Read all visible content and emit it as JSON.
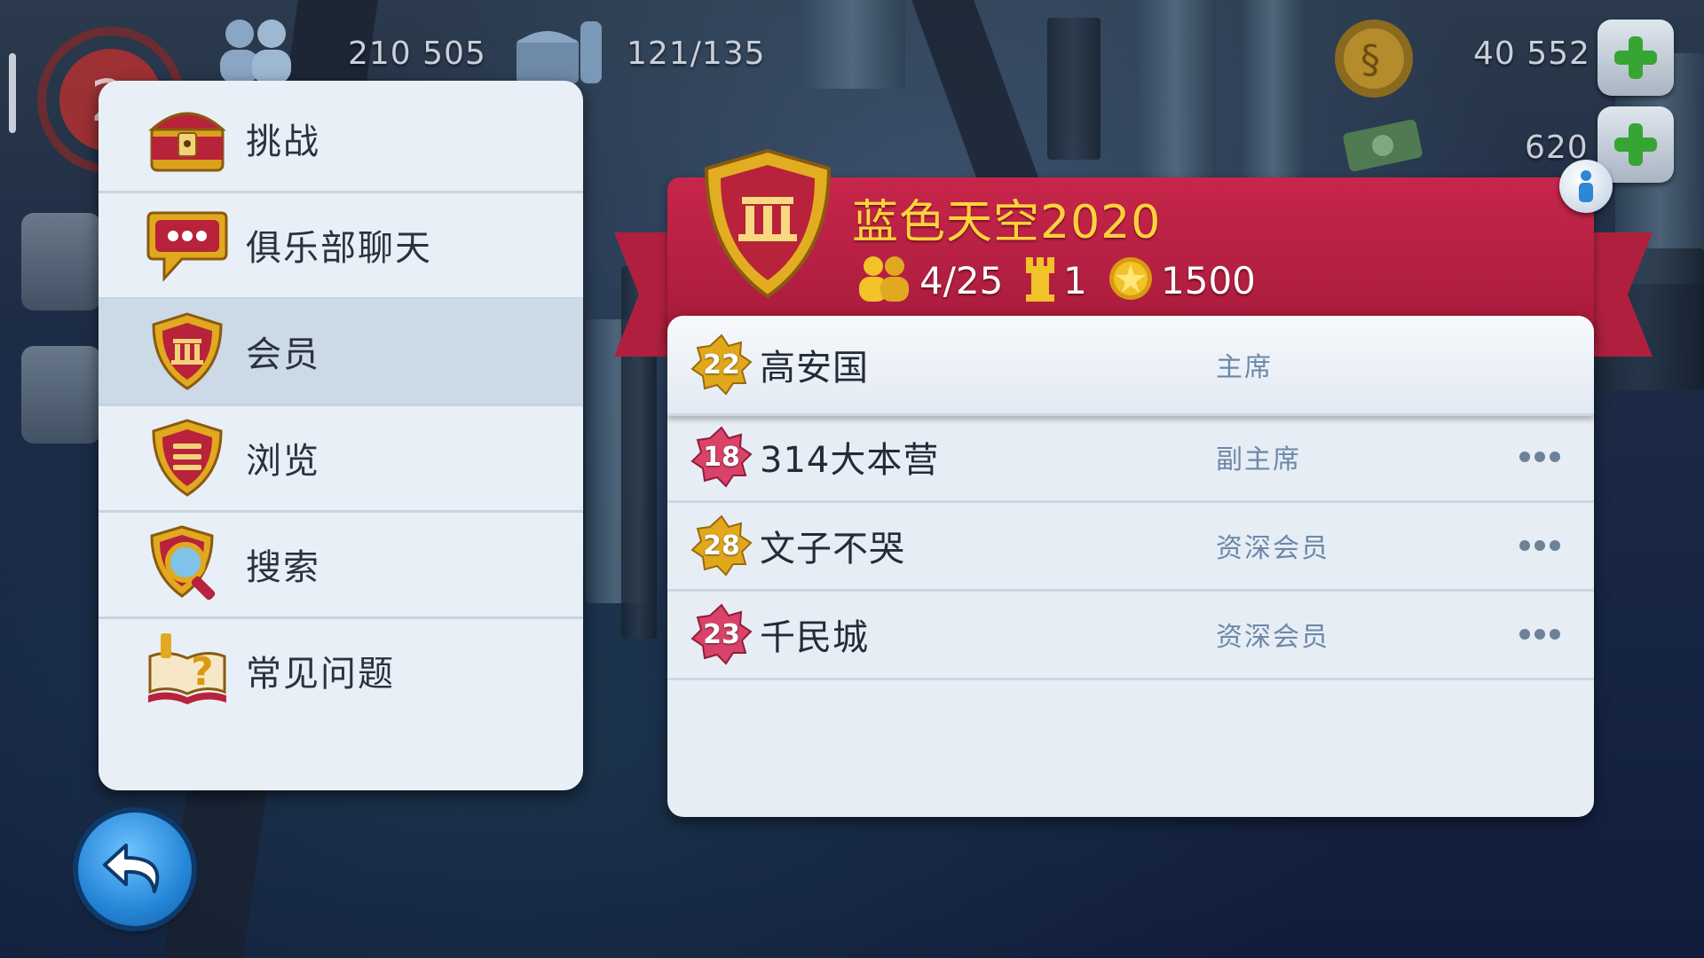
{
  "hud": {
    "population": "210 505",
    "storage": "121/135",
    "simoleons": "40 552",
    "simcash": "620",
    "level": "2"
  },
  "menu": {
    "items": [
      {
        "label": "挑战",
        "icon": "treasure-chest-icon"
      },
      {
        "label": "俱乐部聊天",
        "icon": "chat-bubble-icon"
      },
      {
        "label": "会员",
        "icon": "club-shield-icon"
      },
      {
        "label": "浏览",
        "icon": "list-shield-icon"
      },
      {
        "label": "搜索",
        "icon": "magnifier-shield-icon"
      },
      {
        "label": "常见问题",
        "icon": "faq-book-icon"
      }
    ],
    "active_index": 2
  },
  "club": {
    "name": "蓝色天空2020",
    "members": "4/25",
    "towers": "1",
    "points": "1500",
    "members_list": [
      {
        "level": "22",
        "name": "高安国",
        "role": "主席",
        "badge": "gold"
      },
      {
        "level": "18",
        "name": "314大本营",
        "role": "副主席",
        "badge": "pink"
      },
      {
        "level": "28",
        "name": "文子不哭",
        "role": "资深会员",
        "badge": "gold"
      },
      {
        "level": "23",
        "name": "千民城",
        "role": "资深会员",
        "badge": "pink"
      }
    ]
  },
  "colors": {
    "ribbon": "#c6264a",
    "title": "#ffd23c",
    "role": "#6c89a8",
    "badge_gold": "#e2a81c",
    "badge_pink": "#d9436a"
  }
}
